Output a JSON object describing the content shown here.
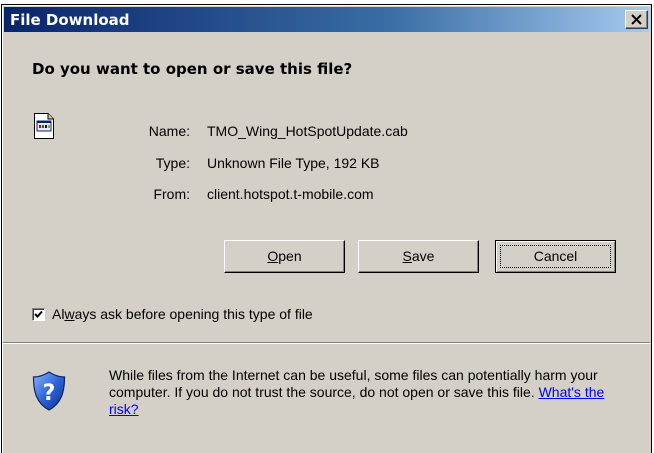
{
  "window": {
    "title": "File Download",
    "close_glyph": "×"
  },
  "dialog": {
    "question": "Do you want to open or save this file?",
    "file_icon": "cab-file-icon",
    "info": {
      "name_label": "Name:",
      "name_value": "TMO_Wing_HotSpotUpdate.cab",
      "type_label": "Type:",
      "type_value": "Unknown File Type, 192 KB",
      "from_label": "From:",
      "from_value": "client.hotspot.t-mobile.com"
    },
    "buttons": {
      "open_hotkey": "O",
      "open_rest": "pen",
      "save_hotkey": "S",
      "save_rest": "ave",
      "cancel": "Cancel"
    },
    "checkbox": {
      "checked": true,
      "label_before": "Al",
      "label_hotkey": "w",
      "label_after": "ays ask before opening this type of file"
    },
    "warning": {
      "icon": "shield-question-icon",
      "text": "While files from the Internet can be useful, some files can potentially harm your computer. If you do not trust the source, do not open or save this file. ",
      "link": "What's the risk?"
    }
  }
}
